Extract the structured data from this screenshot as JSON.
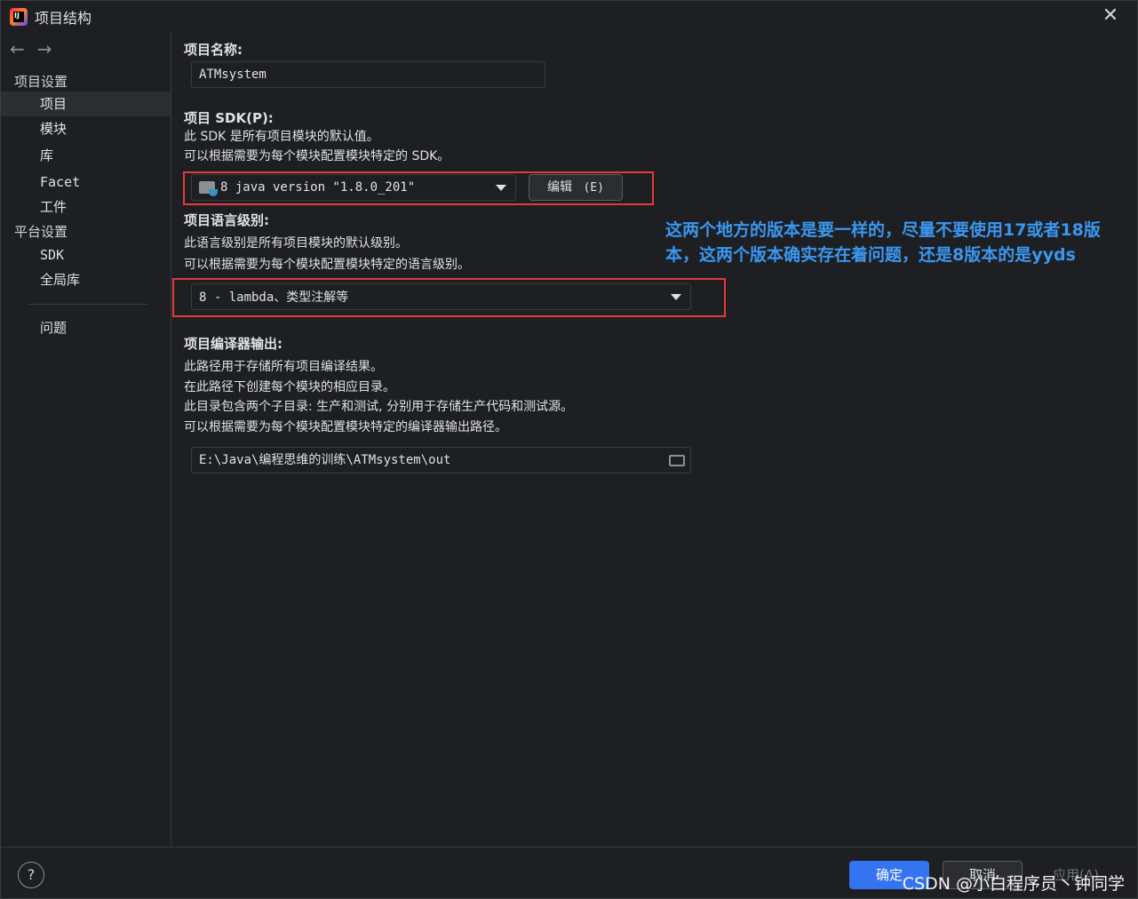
{
  "window": {
    "title": "项目结构",
    "close_label": "✕"
  },
  "nav": {
    "back": "←",
    "forward": "→"
  },
  "sidebar": {
    "project_settings_head": "项目设置",
    "project_settings_items": [
      {
        "label": "项目",
        "selected": true
      },
      {
        "label": "模块"
      },
      {
        "label": "库"
      },
      {
        "label": "Facet"
      },
      {
        "label": "工件"
      }
    ],
    "platform_settings_head": "平台设置",
    "platform_settings_items": [
      {
        "label": "SDK"
      },
      {
        "label": "全局库"
      }
    ],
    "problems_label": "问题"
  },
  "main": {
    "name_label": "项目名称:",
    "name_value": "ATMsystem",
    "sdk_label": "项目 SDK(P):",
    "sdk_desc1": "此 SDK 是所有项目模块的默认值。",
    "sdk_desc2": "可以根据需要为每个模块配置模块特定的 SDK。",
    "sdk_value": "8 java version \"1.8.0_201\"",
    "edit_button": "编辑",
    "edit_mnemonic": "(E)",
    "lang_label": "项目语言级别:",
    "lang_desc1": "此语言级别是所有项目模块的默认级别。",
    "lang_desc2": "可以根据需要为每个模块配置模块特定的语言级别。",
    "lang_value": "8 - lambda、类型注解等",
    "output_label": "项目编译器输出:",
    "output_desc1": "此路径用于存储所有项目编译结果。",
    "output_desc2": "在此路径下创建每个模块的相应目录。",
    "output_desc3": "此目录包含两个子目录: 生产和测试, 分别用于存储生产代码和测试源。",
    "output_desc4": "可以根据需要为每个模块配置模块特定的编译器输出路径。",
    "output_value": "E:\\Java\\编程思维的训练\\ATMsystem\\out"
  },
  "annotation": {
    "text": "这两个地方的版本是要一样的，尽量不要使用17或者18版本，这两个版本确实存在着问题，还是8版本的是yyds",
    "color": "#3a97f0"
  },
  "footer": {
    "help": "?",
    "ok": "确定",
    "cancel": "取消",
    "apply": "应用(A)",
    "watermark": "CSDN @小白程序员丶钟同学"
  }
}
